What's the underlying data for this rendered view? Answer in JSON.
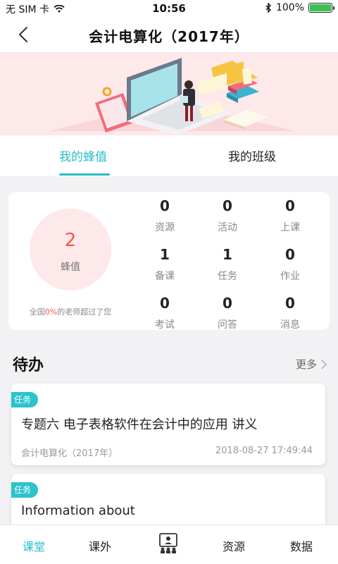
{
  "status": {
    "carrier": "无 SIM 卡",
    "time": "10:56",
    "battery_percent": "100%",
    "battery_level": 1.0
  },
  "nav": {
    "title": "会计电算化（2017年）"
  },
  "tabs": [
    {
      "label": "我的蜂值",
      "active": true
    },
    {
      "label": "我的班级",
      "active": false
    }
  ],
  "summary": {
    "score": "2",
    "score_label": "蜂值",
    "note_prefix": "全国",
    "note_percent": "0%",
    "note_suffix": "的老师超过了您"
  },
  "stats": [
    {
      "value": "0",
      "label": "资源"
    },
    {
      "value": "0",
      "label": "活动"
    },
    {
      "value": "0",
      "label": "上课"
    },
    {
      "value": "1",
      "label": "备课"
    },
    {
      "value": "1",
      "label": "任务"
    },
    {
      "value": "0",
      "label": "作业"
    },
    {
      "value": "0",
      "label": "考试"
    },
    {
      "value": "0",
      "label": "问答"
    },
    {
      "value": "0",
      "label": "消息"
    }
  ],
  "todo": {
    "title": "待办",
    "more_label": "更多",
    "items": [
      {
        "tag": "任务",
        "title": "专题六 电子表格软件在会计中的应用 讲义",
        "course": "会计电算化（2017年）",
        "time": "2018-08-27 17:49:44"
      },
      {
        "tag": "任务",
        "title": "Information about",
        "course": "",
        "time": ""
      }
    ]
  },
  "bottom_nav": [
    {
      "label": "课堂",
      "active": true
    },
    {
      "label": "课外",
      "active": false
    },
    {
      "label": "",
      "icon": "classroom-teacher-icon",
      "active": false
    },
    {
      "label": "资源",
      "active": false
    },
    {
      "label": "数据",
      "active": false
    }
  ],
  "colors": {
    "accent": "#26bec9",
    "highlight": "#f2574f",
    "banner_bg": "#fde8ea"
  }
}
